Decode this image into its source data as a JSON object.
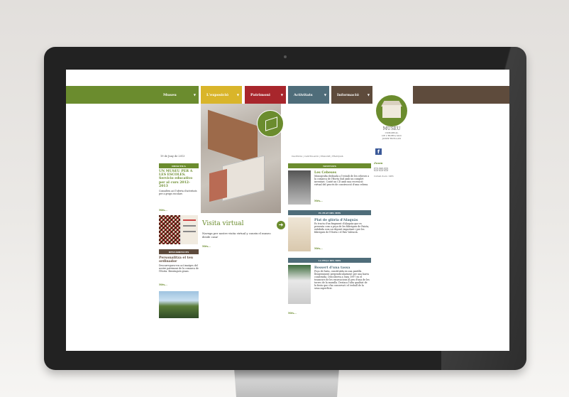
{
  "nav": {
    "items": [
      {
        "label": "Museu",
        "color": "#6b8c2e"
      },
      {
        "label": "L'exposició",
        "color": "#d9b52a"
      },
      {
        "label": "Patrimoni",
        "color": "#a8262c"
      },
      {
        "label": "Activitats",
        "color": "#4f6d7a"
      },
      {
        "label": "Informació",
        "color": "#5e4b3c"
      }
    ]
  },
  "logo": {
    "title": "MUSEU",
    "line2": "COMARCAL",
    "line3": "DE L'HORTA SUD",
    "sub": "JOSEP ROTLLAN"
  },
  "zoom": {
    "label": "Zoom",
    "minus": "−",
    "reset": "=",
    "plus": "+",
    "current": "Current Zoom: 100%"
  },
  "languages": "VALENCIÀ | CASTELLANO | ENGLISH | FRANÇAIS",
  "left": {
    "date": "19 de Juny de 2013",
    "didactica": {
      "header": "DIDÀCTICA",
      "title": "UN MUSEU PER A LES ESCOLES. Servicio educativo per al curs 2012-2013",
      "text": "Consulteu ací l'oferta d'activitats per a grups escolars",
      "more": "Més..."
    },
    "descarregues": {
      "header": "DESCÀRREGUES",
      "title": "Personalitza el teu ordinador",
      "text": "Descarregueu-vos ací imatges del nostre patrimoni de la comarca de l'Horta. Benvinguts grans.",
      "more": "Més..."
    }
  },
  "center": {
    "title": "Visita virtual",
    "desc": "Navega per nostre visita virtual y coneix el museo desde casa!",
    "more": "Més..."
  },
  "right": {
    "novetats": {
      "header": "NOVETATS",
      "title": "Les Cebeses",
      "text": "Monografia dedicada a l'estudi de les cebeses a la comarca de l'Horta Sud amb un complet inventari. Conté un CD amb una recreació virtual del procés de construcció d'una cebesa.",
      "more": "Més..."
    },
    "plat": {
      "header": "EL PLAT DEL MES",
      "title": "Plat de glòria d'Alaquàs",
      "text": "Es tracta d'un fragment d'Alaquàs que es presenta com a peça de les fàbriques de Paiota, exhibida com un deposit important i per les fàbriques de l'Horta i el País Valencià.",
      "more": "Més..."
    },
    "peca": {
      "header": "LA PEÇA DEL MES",
      "title": "Bossert d'una tassa",
      "text": "Peça de fusta, constituïda en una pastilla lleugerament perpendicularment per una barra construïda. Descoberta a l'any 1997 en el transcurs de les excavacions al peu d'una de les torres de la muralla. Destaca l'alta qualitat de la fusta que s'ha conservat i el treball de la seua superfície.",
      "more": "Més..."
    }
  }
}
